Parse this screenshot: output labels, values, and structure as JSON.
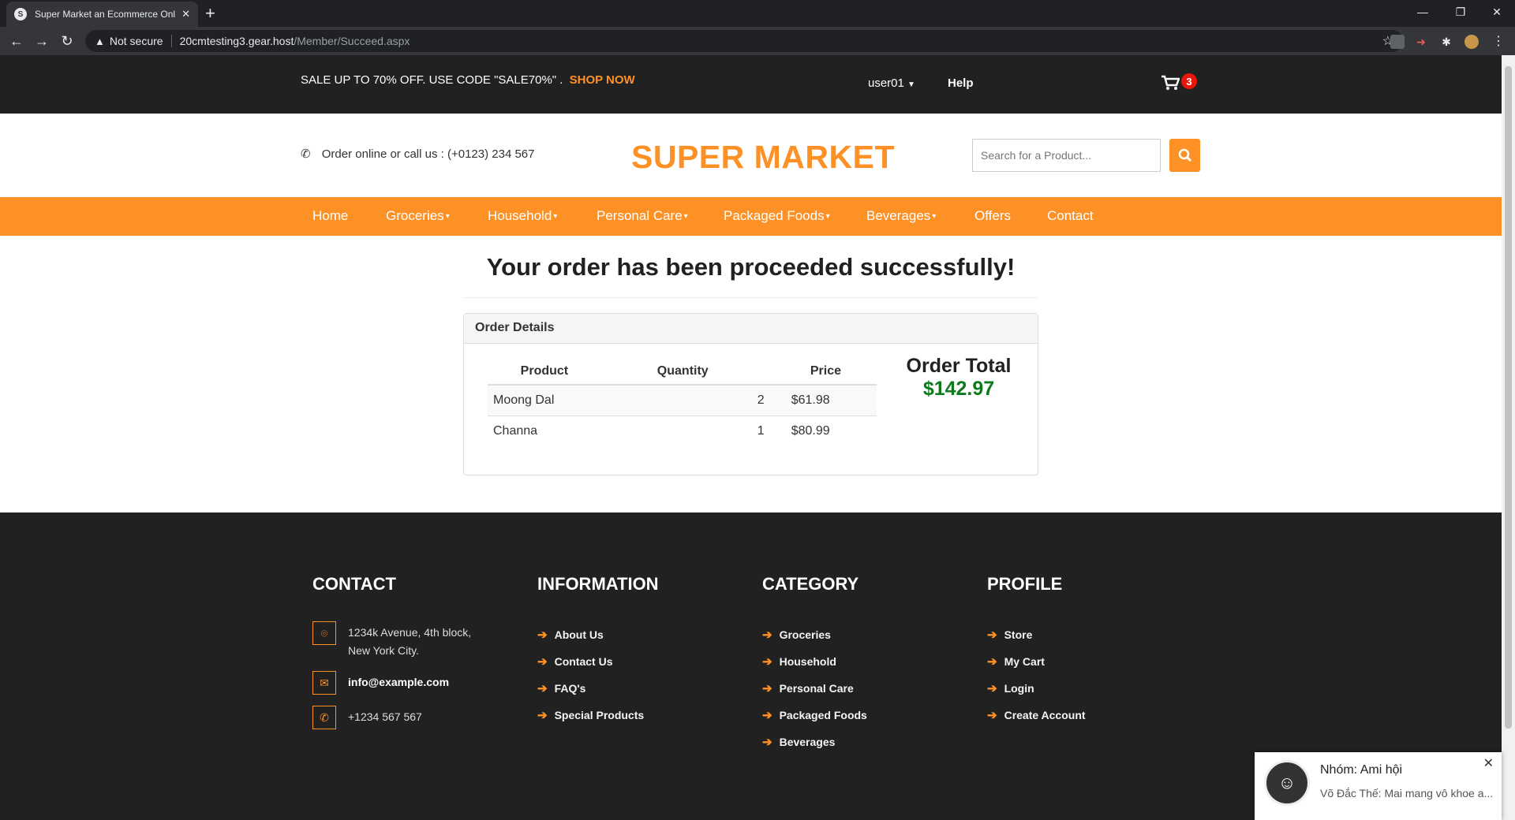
{
  "browser": {
    "tab_title": "Super Market an Ecommerce Onl",
    "tab_close": "✕",
    "new_tab": "+",
    "security_label": "Not secure",
    "url_host": "20cmtesting3.gear.host",
    "url_path": "/Member/Succeed.aspx"
  },
  "topbar": {
    "promo_text": "SALE UP TO 70% OFF. USE CODE \"SALE70%\" .",
    "promo_link": "SHOP NOW",
    "user": "user01",
    "help": "Help",
    "cart_count": "3"
  },
  "header": {
    "call_text": "Order online or call us : (+0123) 234 567",
    "logo": "SUPER MARKET",
    "search_placeholder": "Search for a Product..."
  },
  "nav": {
    "items": [
      "Home",
      "Groceries",
      "Household",
      "Personal Care",
      "Packaged Foods",
      "Beverages",
      "Offers",
      "Contact"
    ]
  },
  "content": {
    "heading": "Your order has been proceeded successfully!",
    "panel_title": "Order Details",
    "columns": [
      "Product",
      "Quantity",
      "Price"
    ],
    "rows": [
      {
        "product": "Moong Dal",
        "quantity": "2",
        "price": "$61.98"
      },
      {
        "product": "Channa",
        "quantity": "1",
        "price": "$80.99"
      }
    ],
    "total_label": "Order Total",
    "total_amount": "$142.97"
  },
  "footer": {
    "contact": {
      "title": "CONTACT",
      "address_line1": "1234k Avenue, 4th block,",
      "address_line2": "New York City.",
      "email": "info@example.com",
      "phone": "+1234 567 567"
    },
    "information": {
      "title": "INFORMATION",
      "links": [
        "About Us",
        "Contact Us",
        "FAQ's",
        "Special Products"
      ]
    },
    "category": {
      "title": "CATEGORY",
      "links": [
        "Groceries",
        "Household",
        "Personal Care",
        "Packaged Foods",
        "Beverages"
      ]
    },
    "profile": {
      "title": "PROFILE",
      "links": [
        "Store",
        "My Cart",
        "Login",
        "Create Account"
      ]
    }
  },
  "notification": {
    "title": "Nhóm: Ami hội",
    "message": "Võ Đắc Thế: Mai mang vô khoe a..."
  },
  "colors": {
    "accent": "#fe9126",
    "dark": "#212121",
    "total_green": "#0e7a1d",
    "badge_red": "#e8160c"
  }
}
